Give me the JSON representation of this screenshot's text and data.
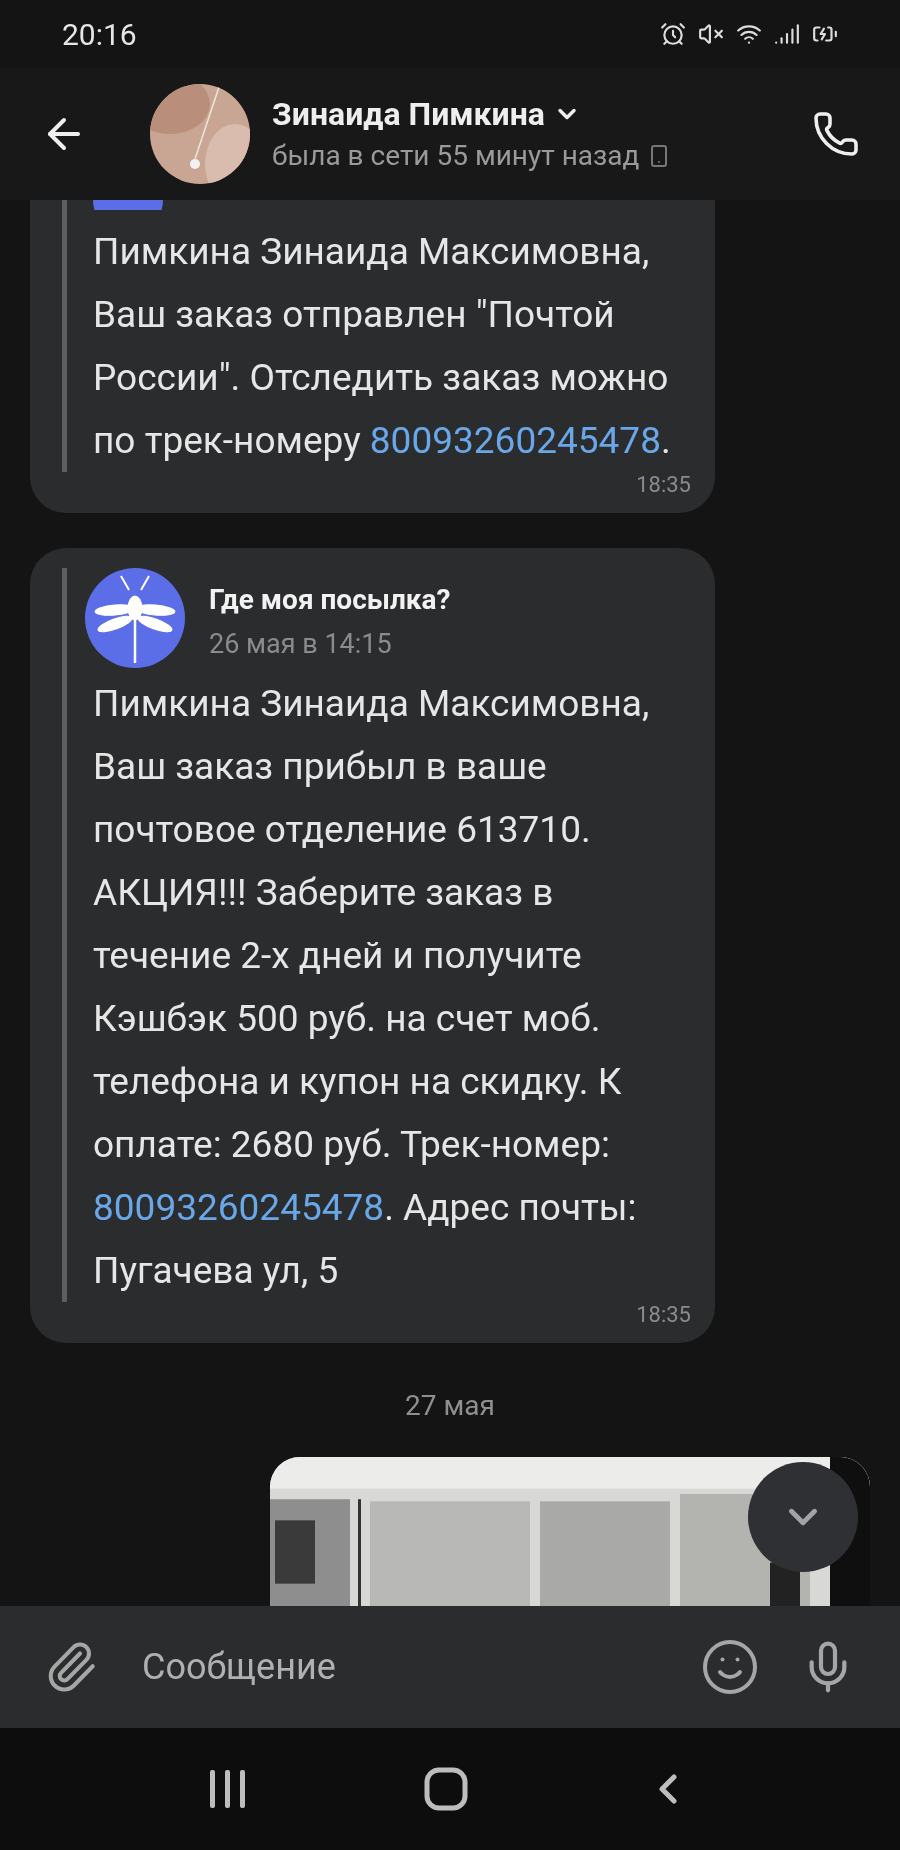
{
  "status_bar": {
    "time": "20:16"
  },
  "header": {
    "name": "Зинаида Пимкина",
    "status": "была в сети 55 минут назад"
  },
  "messages": [
    {
      "kind": "forwarded_cut",
      "body": [
        {
          "kind": "text",
          "text": "Пимкина Зинаида Максимовна, Ваш заказ отправлен \"Почтой России\". Отследить заказ можно по трек-номеру "
        },
        {
          "kind": "link",
          "text": "80093260245478"
        },
        {
          "kind": "text",
          "text": "."
        }
      ],
      "time": "18:35"
    },
    {
      "kind": "forwarded",
      "sender": "Где моя посылка?",
      "date": "26 мая в 14:15",
      "body": [
        {
          "kind": "text",
          "text": "Пимкина Зинаида Максимовна, Ваш заказ прибыл в ваше почтовое отделение 613710. АКЦИЯ!!! Заберите заказ в течение 2-х дней и получите Кэшбэк 500 руб. на счет моб. телефона и купон на скидку. К оплате: 2680 руб. Трек-номер: "
        },
        {
          "kind": "link",
          "text": "80093260245478"
        },
        {
          "kind": "text",
          "text": ". Адрес почты: Пугачева ул, 5"
        }
      ],
      "time": "18:35"
    }
  ],
  "date_separator": "27 мая",
  "composer": {
    "placeholder": "Сообщение"
  }
}
